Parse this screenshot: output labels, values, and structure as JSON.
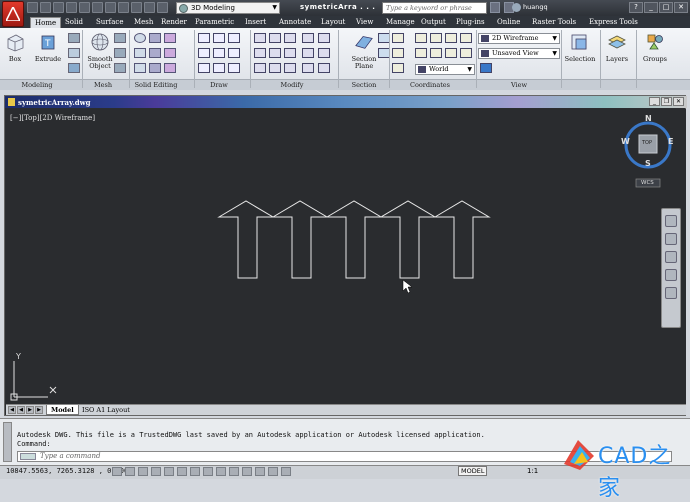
{
  "title_bar": {
    "workspace": "3D Modeling",
    "document_title": "symetricArra . . .",
    "search_placeholder": "Type a keyword or phrase",
    "user": "huangq"
  },
  "ribbon_tabs": [
    "Home",
    "Solid",
    "Surface",
    "Mesh",
    "Render",
    "Parametric",
    "Insert",
    "Annotate",
    "Layout",
    "View",
    "Manage",
    "Output",
    "Plug-ins",
    "Online",
    "Raster Tools",
    "Express Tools"
  ],
  "ribbon": {
    "buttons": {
      "box": "Box",
      "extrude": "Extrude",
      "smooth_object": [
        "Smooth",
        "Object"
      ],
      "section_plane": [
        "Section",
        "Plane"
      ],
      "selection": "Selection",
      "layers": "Layers",
      "groups": "Groups"
    },
    "view_style": "2D Wireframe",
    "named_view": "Unsaved View",
    "ucs": "World",
    "panels": [
      "Modeling",
      "Mesh",
      "Solid Editing",
      "Draw",
      "Modify",
      "Section",
      "Coordinates",
      "View"
    ]
  },
  "document_tab": "symetricArray.dwg",
  "viewport_label": "[−][Top][2D Wireframe]",
  "viewcube": {
    "north": "N",
    "south": "S",
    "east": "E",
    "west": "W",
    "face": "TOP",
    "ucs_label": "WCS"
  },
  "ucs_icon": {
    "y": "Y",
    "x": "X"
  },
  "layout_tabs": [
    "Model",
    "ISO A1 Layout"
  ],
  "command": {
    "history": [
      "Autodesk DWG.  This file is a TrustedDWG last saved by an Autodesk application or Autodesk licensed application.",
      "Command:"
    ],
    "placeholder": "Type a command"
  },
  "status": {
    "coordinates": "10847.5563, 7265.3128 , 0.0000",
    "model": "MODEL",
    "scale": "1:1"
  },
  "watermark": "CAD之家"
}
